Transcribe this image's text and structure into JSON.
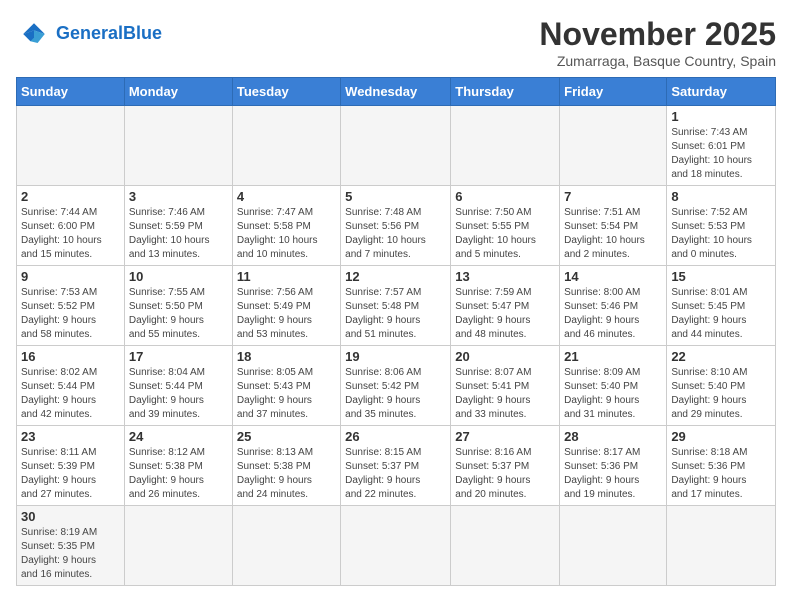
{
  "logo": {
    "general": "General",
    "blue": "Blue"
  },
  "title": "November 2025",
  "location": "Zumarraga, Basque Country, Spain",
  "weekdays": [
    "Sunday",
    "Monday",
    "Tuesday",
    "Wednesday",
    "Thursday",
    "Friday",
    "Saturday"
  ],
  "weeks": [
    [
      {
        "day": "",
        "info": ""
      },
      {
        "day": "",
        "info": ""
      },
      {
        "day": "",
        "info": ""
      },
      {
        "day": "",
        "info": ""
      },
      {
        "day": "",
        "info": ""
      },
      {
        "day": "",
        "info": ""
      },
      {
        "day": "1",
        "info": "Sunrise: 7:43 AM\nSunset: 6:01 PM\nDaylight: 10 hours\nand 18 minutes."
      }
    ],
    [
      {
        "day": "2",
        "info": "Sunrise: 7:44 AM\nSunset: 6:00 PM\nDaylight: 10 hours\nand 15 minutes."
      },
      {
        "day": "3",
        "info": "Sunrise: 7:46 AM\nSunset: 5:59 PM\nDaylight: 10 hours\nand 13 minutes."
      },
      {
        "day": "4",
        "info": "Sunrise: 7:47 AM\nSunset: 5:58 PM\nDaylight: 10 hours\nand 10 minutes."
      },
      {
        "day": "5",
        "info": "Sunrise: 7:48 AM\nSunset: 5:56 PM\nDaylight: 10 hours\nand 7 minutes."
      },
      {
        "day": "6",
        "info": "Sunrise: 7:50 AM\nSunset: 5:55 PM\nDaylight: 10 hours\nand 5 minutes."
      },
      {
        "day": "7",
        "info": "Sunrise: 7:51 AM\nSunset: 5:54 PM\nDaylight: 10 hours\nand 2 minutes."
      },
      {
        "day": "8",
        "info": "Sunrise: 7:52 AM\nSunset: 5:53 PM\nDaylight: 10 hours\nand 0 minutes."
      }
    ],
    [
      {
        "day": "9",
        "info": "Sunrise: 7:53 AM\nSunset: 5:52 PM\nDaylight: 9 hours\nand 58 minutes."
      },
      {
        "day": "10",
        "info": "Sunrise: 7:55 AM\nSunset: 5:50 PM\nDaylight: 9 hours\nand 55 minutes."
      },
      {
        "day": "11",
        "info": "Sunrise: 7:56 AM\nSunset: 5:49 PM\nDaylight: 9 hours\nand 53 minutes."
      },
      {
        "day": "12",
        "info": "Sunrise: 7:57 AM\nSunset: 5:48 PM\nDaylight: 9 hours\nand 51 minutes."
      },
      {
        "day": "13",
        "info": "Sunrise: 7:59 AM\nSunset: 5:47 PM\nDaylight: 9 hours\nand 48 minutes."
      },
      {
        "day": "14",
        "info": "Sunrise: 8:00 AM\nSunset: 5:46 PM\nDaylight: 9 hours\nand 46 minutes."
      },
      {
        "day": "15",
        "info": "Sunrise: 8:01 AM\nSunset: 5:45 PM\nDaylight: 9 hours\nand 44 minutes."
      }
    ],
    [
      {
        "day": "16",
        "info": "Sunrise: 8:02 AM\nSunset: 5:44 PM\nDaylight: 9 hours\nand 42 minutes."
      },
      {
        "day": "17",
        "info": "Sunrise: 8:04 AM\nSunset: 5:44 PM\nDaylight: 9 hours\nand 39 minutes."
      },
      {
        "day": "18",
        "info": "Sunrise: 8:05 AM\nSunset: 5:43 PM\nDaylight: 9 hours\nand 37 minutes."
      },
      {
        "day": "19",
        "info": "Sunrise: 8:06 AM\nSunset: 5:42 PM\nDaylight: 9 hours\nand 35 minutes."
      },
      {
        "day": "20",
        "info": "Sunrise: 8:07 AM\nSunset: 5:41 PM\nDaylight: 9 hours\nand 33 minutes."
      },
      {
        "day": "21",
        "info": "Sunrise: 8:09 AM\nSunset: 5:40 PM\nDaylight: 9 hours\nand 31 minutes."
      },
      {
        "day": "22",
        "info": "Sunrise: 8:10 AM\nSunset: 5:40 PM\nDaylight: 9 hours\nand 29 minutes."
      }
    ],
    [
      {
        "day": "23",
        "info": "Sunrise: 8:11 AM\nSunset: 5:39 PM\nDaylight: 9 hours\nand 27 minutes."
      },
      {
        "day": "24",
        "info": "Sunrise: 8:12 AM\nSunset: 5:38 PM\nDaylight: 9 hours\nand 26 minutes."
      },
      {
        "day": "25",
        "info": "Sunrise: 8:13 AM\nSunset: 5:38 PM\nDaylight: 9 hours\nand 24 minutes."
      },
      {
        "day": "26",
        "info": "Sunrise: 8:15 AM\nSunset: 5:37 PM\nDaylight: 9 hours\nand 22 minutes."
      },
      {
        "day": "27",
        "info": "Sunrise: 8:16 AM\nSunset: 5:37 PM\nDaylight: 9 hours\nand 20 minutes."
      },
      {
        "day": "28",
        "info": "Sunrise: 8:17 AM\nSunset: 5:36 PM\nDaylight: 9 hours\nand 19 minutes."
      },
      {
        "day": "29",
        "info": "Sunrise: 8:18 AM\nSunset: 5:36 PM\nDaylight: 9 hours\nand 17 minutes."
      }
    ],
    [
      {
        "day": "30",
        "info": "Sunrise: 8:19 AM\nSunset: 5:35 PM\nDaylight: 9 hours\nand 16 minutes."
      },
      {
        "day": "",
        "info": ""
      },
      {
        "day": "",
        "info": ""
      },
      {
        "day": "",
        "info": ""
      },
      {
        "day": "",
        "info": ""
      },
      {
        "day": "",
        "info": ""
      },
      {
        "day": "",
        "info": ""
      }
    ]
  ]
}
